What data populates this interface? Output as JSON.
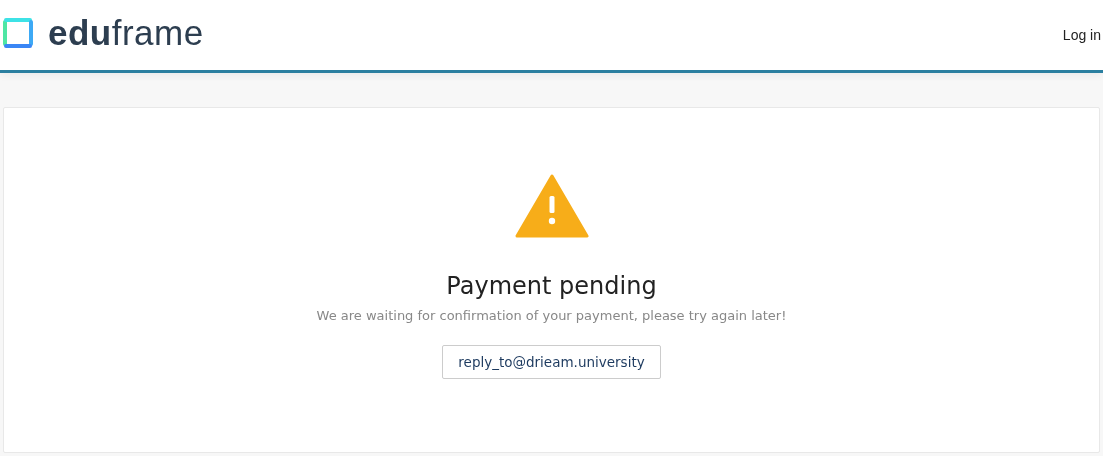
{
  "header": {
    "logo": "**edu**frame",
    "login_link": "Log in"
  },
  "message": {
    "title": "Payment pending",
    "text": "We are waiting for confirmation of your payment, please try again later!",
    "email_button": "reply_to@drieam.university"
  }
}
